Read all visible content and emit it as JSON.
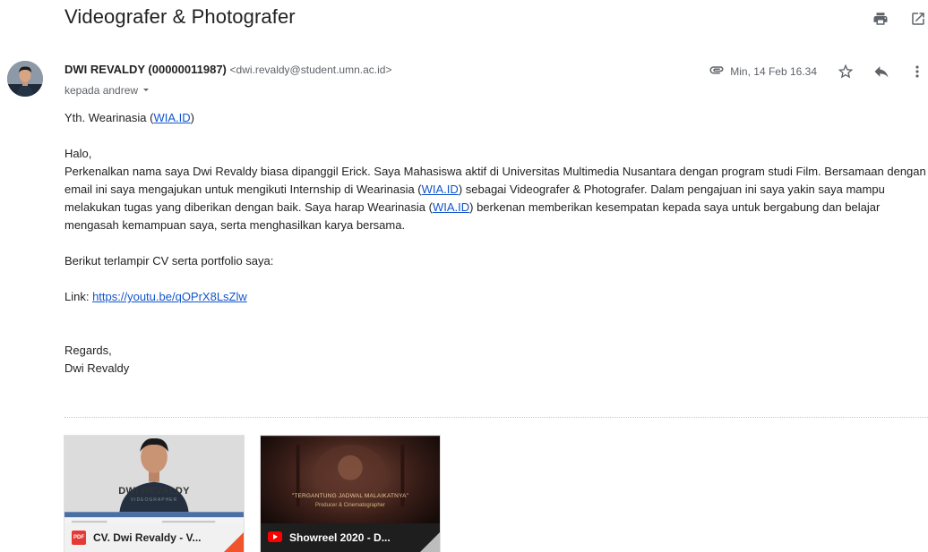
{
  "subject": "Videografer & Photografer",
  "sender": {
    "name": "DWI REVALDY (00000011987)",
    "email": "<dwi.revaldy@student.umn.ac.id>",
    "recipient": "kepada andrew"
  },
  "meta": {
    "date": "Min, 14 Feb 16.34"
  },
  "body": {
    "greeting_prefix": "Yth. Wearinasia (",
    "link_wia": "WIA.ID",
    "greeting_suffix": ")",
    "halo": "Halo,",
    "p1_a": "Perkenalkan nama saya Dwi Revaldy biasa dipanggil Erick. Saya Mahasiswa aktif di Universitas Multimedia Nusantara dengan program studi Film. Bersamaan dengan email ini saya mengajukan untuk mengikuti Internship di Wearinasia (",
    "p1_b": ") sebagai Videografer & Photografer. Dalam pengajuan ini saya yakin saya mampu melakukan tugas yang diberikan dengan baik. Saya harap Wearinasia (",
    "p1_c": ") berkenan memberikan kesempatan kepada saya untuk bergabung dan belajar mengasah kemampuan saya, serta menghasilkan karya bersama.",
    "attached_line": "Berikut terlampir CV serta portfolio saya:",
    "link_label": "Link: ",
    "link_url": "https://youtu.be/qOPrX8LsZlw",
    "regards": "Regards,",
    "signature": "Dwi Revaldy"
  },
  "attachments": [
    {
      "name": "CV. Dwi Revaldy - V...",
      "type_badge": "PDF",
      "thumb_title": "DWI REVALDY",
      "thumb_subtitle": "VIDEOGRAPHER"
    },
    {
      "name": "Showreel 2020 - D...",
      "type_icon": "youtube-icon",
      "thumb_line1": "\"TERGANTUNG JADWAL MALAIKATNYA\"",
      "thumb_line2": "Producer & Cinematographer"
    }
  ],
  "icons": [
    "print-icon",
    "open-new-window-icon",
    "attachment-icon",
    "star-icon",
    "reply-icon",
    "more-vert-icon",
    "dropdown-icon"
  ],
  "colors": {
    "link": "#1155cc",
    "icon": "#5f6368",
    "pdf": "#e53935",
    "youtube": "#ff0000"
  }
}
